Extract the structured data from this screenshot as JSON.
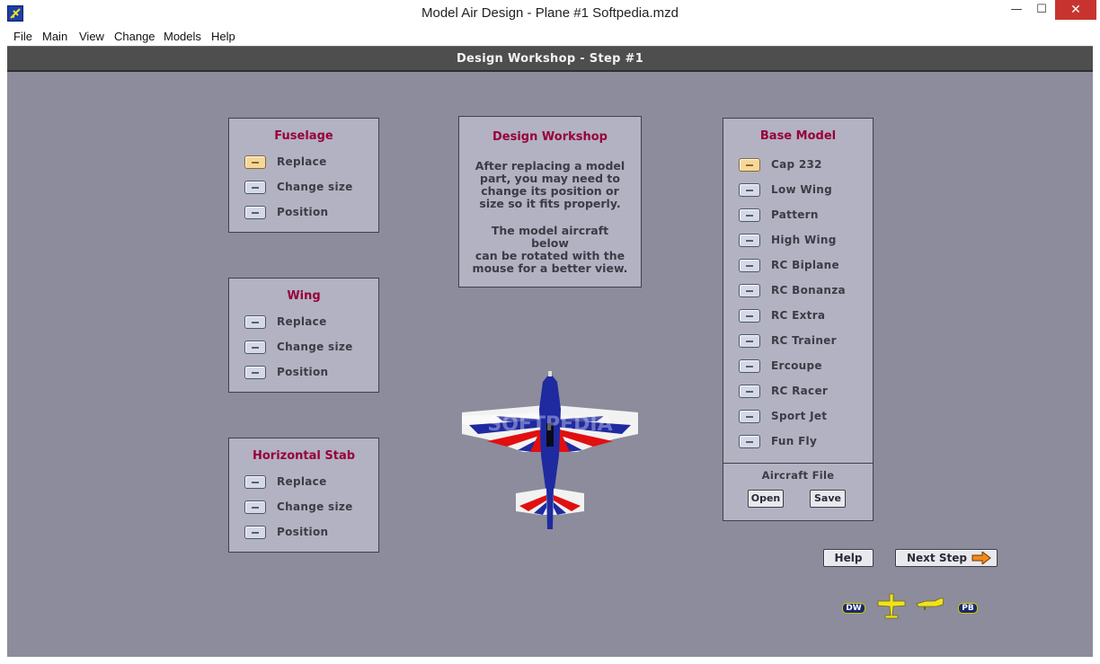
{
  "window": {
    "title": "Model Air Design - Plane #1  Softpedia.mzd",
    "minimize_glyph": "—",
    "maximize_glyph": "☐",
    "close_glyph": "✕"
  },
  "menu": [
    "File",
    "Main",
    "View",
    "Change",
    "Models",
    "Help"
  ],
  "header": {
    "title": "Design Workshop  -  Step #1"
  },
  "panels": {
    "fuselage": {
      "title": "Fuselage",
      "options": [
        "Replace",
        "Change size",
        "Position"
      ],
      "selected": "Replace"
    },
    "wing": {
      "title": "Wing",
      "options": [
        "Replace",
        "Change size",
        "Position"
      ]
    },
    "hstab": {
      "title": "Horizontal Stab",
      "options": [
        "Replace",
        "Change size",
        "Position"
      ]
    }
  },
  "info": {
    "title": "Design Workshop",
    "paragraph1": [
      "After replacing a model",
      "part, you may need to",
      "change its position or",
      "size so it fits properly."
    ],
    "paragraph2": [
      "The model aircraft below",
      "can be rotated with the",
      "mouse for a better view."
    ]
  },
  "base_model": {
    "title": "Base Model",
    "models": [
      "Cap 232",
      "Low Wing",
      "Pattern",
      "High Wing",
      "RC Biplane",
      "RC Bonanza",
      "RC Extra",
      "RC Trainer",
      "Ercoupe",
      "RC Racer",
      "Sport Jet",
      "Fun Fly"
    ],
    "selected": "Cap 232",
    "aircraft_file_label": "Aircraft File",
    "open_label": "Open",
    "save_label": "Save"
  },
  "buttons": {
    "help": "Help",
    "next_step": "Next Step"
  },
  "view_badges": {
    "left": "DW",
    "right": "PB"
  },
  "watermark": "SOFTPEDIA",
  "icons": {
    "app": "plane-app-icon",
    "next_step_arrow": "arrow-right-icon",
    "top_view": "plane-top-view-icon",
    "side_view": "plane-side-view-icon"
  },
  "colors": {
    "workspace": "#8c8c9c",
    "panel": "#b2b2c2",
    "panel_title": "#99003a",
    "header_bar": "#4e4e4e",
    "plane_blue": "#1f2aa0",
    "plane_red": "#e01010",
    "view_icon_yellow": "#f2e21a"
  }
}
